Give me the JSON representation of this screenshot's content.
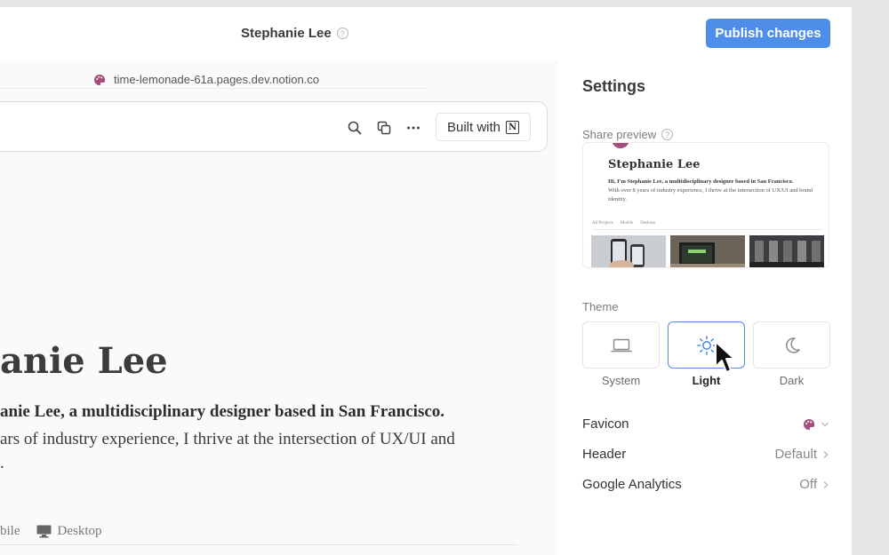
{
  "topbar": {
    "title": "Stephanie Lee",
    "help_glyph": "?",
    "publish_label": "Publish changes"
  },
  "preview": {
    "url": "time-lemonade-61a.pages.dev.notion.co",
    "header_icons": [
      "search-icon",
      "duplicate-icon",
      "more-icon"
    ],
    "built_with_label": "Built with",
    "built_with_logo_glyph": "N",
    "hero_name": "anie Lee",
    "hero_bold": "anie Lee, a multidisciplinary designer based in San Francisco.",
    "hero_line1": "ars of industry experience, I thrive at the intersection of UX/UI and",
    "hero_line2": ".",
    "tabs": [
      {
        "label": "bile",
        "icon": "mobile-icon"
      },
      {
        "label": "Desktop",
        "icon": "desktop-icon"
      }
    ]
  },
  "settings": {
    "title": "Settings",
    "share_preview_label": "Share preview",
    "share_preview": {
      "name": "Stephanie Lee",
      "bio_bold": "Hi, I'm Stephanie Lee, a multidisciplinary designer based in San Francisco.",
      "bio": "With over 8 years of industry experience, I thrive at the intersection of UX/UI and brand identity.",
      "tabs": [
        "All Projects",
        "Mobile",
        "Desktop"
      ]
    },
    "theme_label": "Theme",
    "themes": [
      {
        "label": "System",
        "icon": "laptop-icon",
        "selected": false
      },
      {
        "label": "Light",
        "icon": "sun-icon",
        "selected": true
      },
      {
        "label": "Dark",
        "icon": "moon-icon",
        "selected": false
      }
    ],
    "rows": [
      {
        "label": "Favicon",
        "value": "",
        "value_icon": "palette-icon"
      },
      {
        "label": "Header",
        "value": "Default"
      },
      {
        "label": "Google Analytics",
        "value": "Off"
      }
    ],
    "colors": {
      "accent": "#4f8ee8",
      "favicon": "#a24e7d"
    }
  }
}
